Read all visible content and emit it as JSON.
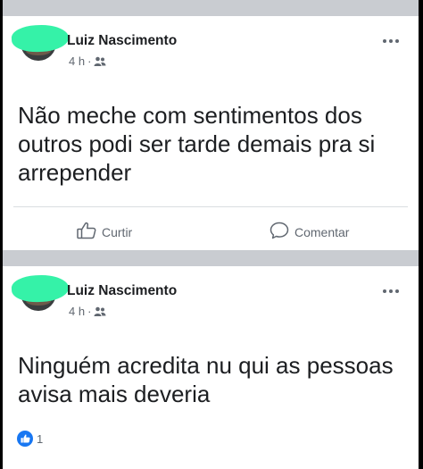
{
  "posts": [
    {
      "author": "Luiz Nascimento",
      "time": "4 h",
      "separator": "·",
      "text": "Não meche com sentimentos dos outros podi ser tarde demais pra si arrepender",
      "like_label": "Curtir",
      "comment_label": "Comentar"
    },
    {
      "author": "Luiz Nascimento",
      "time": "4 h",
      "separator": "·",
      "text": "Ninguém  acredita nu qui as pessoas avisa mais deveria",
      "reaction_count": "1"
    }
  ],
  "icons": {
    "audience": "friends-icon",
    "more": "more-options-icon",
    "like": "thumbs-up-icon",
    "comment": "speech-bubble-icon",
    "reaction": "like-reaction-icon"
  },
  "colors": {
    "accent": "#1877f2",
    "text": "#1c1e21",
    "muted": "#606770",
    "redaction": "#35f2a8"
  }
}
